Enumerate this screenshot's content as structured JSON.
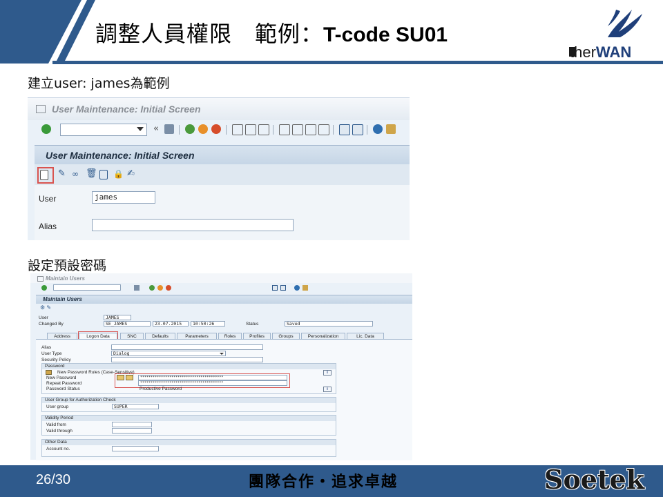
{
  "slide": {
    "title_zh": "調整人員權限　範例：",
    "title_code": "T-code SU01",
    "logo": "EtherWAN",
    "logo_prefix": "E",
    "logo_mid": "ther",
    "logo_suffix": "WAN",
    "caption1": "建立user:  james為範例",
    "caption2": "設定預設密碼",
    "page_number": "26/30",
    "motto": "團隊合作・追求卓越",
    "brand": "Soetek"
  },
  "sap_initial": {
    "window_title": "User Maintenance: Initial Screen",
    "screen_title": "User Maintenance: Initial Screen",
    "user_label": "User",
    "user_value": "james",
    "alias_label": "Alias",
    "alias_value": ""
  },
  "sap_maintain": {
    "window_title": "Maintain Users",
    "screen_title": "Maintain Users",
    "user_label": "User",
    "user_value": "JAMES",
    "changed_by_label": "Changed By",
    "changed_by_value": "SE_JAMES",
    "changed_date": "23.07.2015",
    "changed_time": "10:50:26",
    "status_label": "Status",
    "status_value": "Saved",
    "tabs": [
      "Address",
      "Logon Data",
      "SNC",
      "Defaults",
      "Parameters",
      "Roles",
      "Profiles",
      "Groups",
      "Personalization",
      "Lic. Data"
    ],
    "active_tab": "Logon Data",
    "alias_label": "Alias",
    "user_type_label": "User Type",
    "user_type_value": "Dialog",
    "security_policy_label": "Security Policy",
    "password_group": "Password",
    "new_pw_rules": "New Password Rules (Case-Sensitive)",
    "new_password_label": "New Password",
    "new_password_value": "****************************************",
    "repeat_password_label": "Repeat Password",
    "repeat_password_value": "****************************************",
    "password_status_label": "Password Status",
    "password_status_value": "Productive Password",
    "auth_group": "User Group for Authorization Check",
    "user_group_label": "User group",
    "user_group_value": "SUPER",
    "validity_group": "Validity Period",
    "valid_from_label": "Valid from",
    "valid_through_label": "Valid through",
    "other_group": "Other Data",
    "account_label": "Account no."
  },
  "colors": {
    "accent_blue": "#2f5a8c",
    "highlight_red": "#d9534f"
  }
}
